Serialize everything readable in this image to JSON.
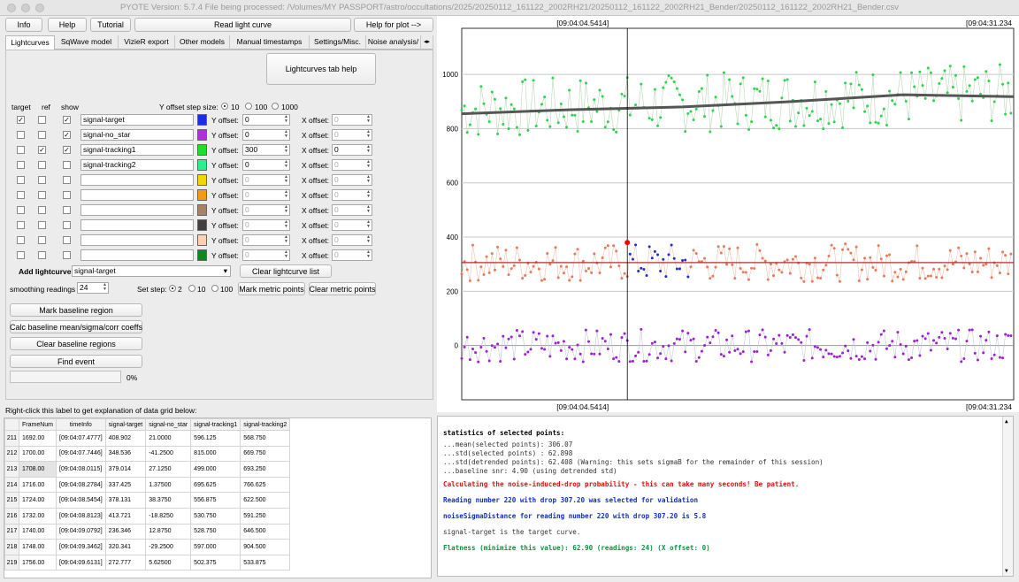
{
  "window": {
    "title": "PYOTE Version: 5.7.4  File being processed: /Volumes/MY PASSPORT/astro/occultations/2025/20250112_161122_2002RH21/20250112_161122_2002RH21_Bender/20250112_161122_2002RH21_Bender.csv"
  },
  "toolbar": {
    "info": "Info",
    "help": "Help",
    "tutorial": "Tutorial",
    "read_lc": "Read light curve",
    "help_plot": "Help for plot -->"
  },
  "tabs": [
    "Lightcurves",
    "SqWave model",
    "VizieR export",
    "Other models",
    "Manual timestamps",
    "Settings/Misc.",
    "Noise analysis/"
  ],
  "lc_help": "Lightcurves tab help",
  "headers": {
    "target": "target",
    "ref": "ref",
    "show": "show",
    "yoffset_step": "Y offset step size:"
  },
  "step_options": [
    "10",
    "100",
    "1000"
  ],
  "row_labels": {
    "y": "Y offset:",
    "x": "X offset:"
  },
  "curves": [
    {
      "name": "signal-target",
      "color": "#1a2ee8",
      "target": true,
      "ref": false,
      "show": true,
      "yoff": "0",
      "xoff": "0",
      "enabled": true
    },
    {
      "name": "signal-no_star",
      "color": "#b52be0",
      "target": false,
      "ref": false,
      "show": true,
      "yoff": "0",
      "xoff": "0",
      "enabled": true
    },
    {
      "name": "signal-tracking1",
      "color": "#1ee025",
      "target": false,
      "ref": true,
      "show": true,
      "yoff": "300",
      "xoff": "0",
      "enabled": true
    },
    {
      "name": "signal-tracking2",
      "color": "#28f08a",
      "target": false,
      "ref": false,
      "show": false,
      "yoff": "0",
      "xoff": "0",
      "enabled": true
    },
    {
      "name": "",
      "color": "#f0d800",
      "target": false,
      "ref": false,
      "show": false,
      "yoff": "0",
      "xoff": "0",
      "enabled": false
    },
    {
      "name": "",
      "color": "#f39c12",
      "target": false,
      "ref": false,
      "show": false,
      "yoff": "0",
      "xoff": "0",
      "enabled": false
    },
    {
      "name": "",
      "color": "#a9806a",
      "target": false,
      "ref": false,
      "show": false,
      "yoff": "0",
      "xoff": "0",
      "enabled": false
    },
    {
      "name": "",
      "color": "#404040",
      "target": false,
      "ref": false,
      "show": false,
      "yoff": "0",
      "xoff": "0",
      "enabled": false
    },
    {
      "name": "",
      "color": "#ffd1b0",
      "target": false,
      "ref": false,
      "show": false,
      "yoff": "0",
      "xoff": "0",
      "enabled": false
    },
    {
      "name": "",
      "color": "#0a8a1a",
      "target": false,
      "ref": false,
      "show": false,
      "yoff": "0",
      "xoff": "0",
      "enabled": false
    }
  ],
  "controls": {
    "add_lc": "Add lightcurve",
    "add_lc_value": "signal-target",
    "clear_lc": "Clear lightcurve list",
    "smoothing": "smoothing readings",
    "smoothing_value": "24",
    "set_step": "Set step:",
    "set_step_options": [
      "2",
      "10",
      "100"
    ],
    "mark_metric": "Mark metric points",
    "clear_metric": "Clear metric points",
    "mark_baseline": "Mark baseline region",
    "calc_baseline": "Calc baseline mean/sigma/corr coeffs",
    "clear_baseline": "Clear baseline regions",
    "find_event": "Find event",
    "progress": "0%",
    "progress_value": 0
  },
  "grid_hint": "Right-click this label to get explanation of data grid below:",
  "grid": {
    "columns": [
      "FrameNum",
      "timeInfo",
      "signal-target",
      "signal-no_star",
      "signal-tracking1",
      "signal-tracking2"
    ],
    "rows": [
      [
        "211",
        "1692.00",
        "[09:04:07.4777]",
        "408.902",
        "21.0000",
        "596.125",
        "568.750"
      ],
      [
        "212",
        "1700.00",
        "[09:04:07.7446]",
        "348.536",
        "-41.2500",
        "815.000",
        "669.750"
      ],
      [
        "213",
        "1708.00",
        "[09:04:08.0115]",
        "379.014",
        "27.1250",
        "499.000",
        "693.250"
      ],
      [
        "214",
        "1716.00",
        "[09:04:08.2784]",
        "337.425",
        "1.37500",
        "695.625",
        "766.625"
      ],
      [
        "215",
        "1724.00",
        "[09:04:08.5454]",
        "378.131",
        "38.3750",
        "556.875",
        "622.500"
      ],
      [
        "216",
        "1732.00",
        "[09:04:08.8123]",
        "413.721",
        "-18.8250",
        "530.750",
        "591.250"
      ],
      [
        "217",
        "1740.00",
        "[09:04:09.0792]",
        "236.346",
        "12.8750",
        "528.750",
        "646.500"
      ],
      [
        "218",
        "1748.00",
        "[09:04:09.3462]",
        "320.341",
        "-29.2500",
        "597.000",
        "904.500"
      ],
      [
        "219",
        "1756.00",
        "[09:04:09.6131]",
        "272.777",
        "5.62500",
        "502.375",
        "533.875"
      ]
    ]
  },
  "log": [
    {
      "text": "statistics of selected points:",
      "color": "#000000",
      "bold": true
    },
    {
      "text": "...mean(selected points): 306.07",
      "color": "#333333",
      "bold": false
    },
    {
      "text": "...std(selected points) : 62.898",
      "color": "#333333",
      "bold": false
    },
    {
      "text": "...std(detrended points): 62.408 (Warning: this sets sigmaB for the remainder of this session)",
      "color": "#333333",
      "bold": false
    },
    {
      "text": "...baseline snr: 4.90 (using detrended std)",
      "color": "#333333",
      "bold": false
    },
    {
      "text": "Calculating the noise-induced-drop probability - this can take many seconds! Be patient.",
      "color": "#e01010",
      "bold": true
    },
    {
      "text": "Reading number 220 with drop 307.20 was selected for validation",
      "color": "#1030c0",
      "bold": true
    },
    {
      "text": "noiseSigmaDistance for reading number 220 with drop 307.20 is 5.8",
      "color": "#1030c0",
      "bold": true
    },
    {
      "text": "signal-target is the target curve.",
      "color": "#333333",
      "bold": false
    },
    {
      "text": "Flatness (minimize this value): 62.90 (readings: 24) (X offset: 0)",
      "color": "#109040",
      "bold": true
    }
  ],
  "chart": {
    "top_left_label": "[09:04:04.5414]",
    "top_right_label": "[09:04:31.234",
    "bottom_left_label": "[09:04:04.5414]",
    "bottom_right_label": "[09:04:31.234",
    "ylim": [
      -200,
      1170
    ],
    "yticks": [
      0,
      200,
      400,
      600,
      800,
      1000
    ],
    "series_colors": {
      "tracking1": "#2bd44a",
      "target": "#e87a5a",
      "no_star": "#a020d0",
      "selected": "#1d2fd0",
      "fit": "#555555",
      "mean": "#b03030",
      "marker": "#ff0000"
    }
  },
  "chart_data": {
    "type": "line",
    "x_range": [
      0,
      200
    ],
    "ylim": [
      -200,
      1170
    ],
    "yticks": [
      0,
      200,
      400,
      600,
      800,
      1000
    ],
    "series": [
      {
        "name": "signal-tracking1",
        "baseline": 870,
        "amplitude": 110
      },
      {
        "name": "signal-target",
        "baseline": 306,
        "amplitude": 70
      },
      {
        "name": "signal-no_star",
        "baseline": 0,
        "amplitude": 60
      }
    ],
    "smoothed_fit": [
      [
        0,
        855
      ],
      [
        40,
        870
      ],
      [
        80,
        880
      ],
      [
        120,
        900
      ],
      [
        160,
        925
      ],
      [
        200,
        918
      ]
    ],
    "target_mean": 306,
    "cursor_x": 60,
    "selected_point": [
      60,
      380
    ]
  }
}
